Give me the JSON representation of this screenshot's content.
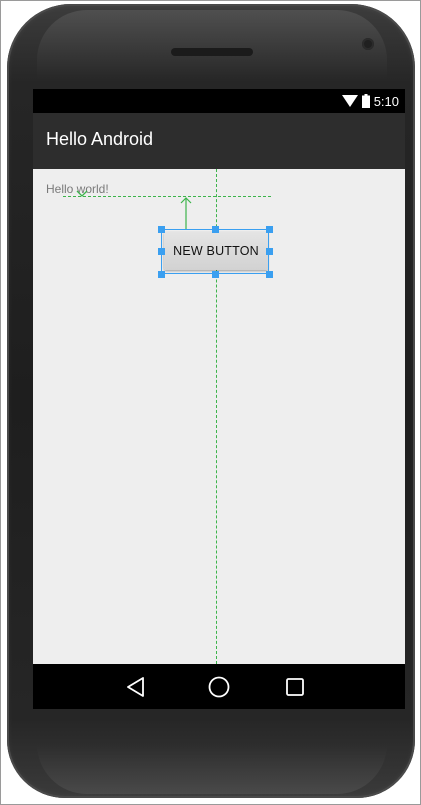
{
  "status_bar": {
    "time": "5:10"
  },
  "action_bar": {
    "title": "Hello Android"
  },
  "content": {
    "text_view": "Hello world!",
    "button_label": "NEW BUTTON"
  },
  "nav_bar": {
    "back": "back-icon",
    "home": "home-icon",
    "recents": "recents-icon"
  },
  "colors": {
    "action_bar": "#2d2d2d",
    "content_bg": "#eeeeee",
    "guide_green": "#3cb44b",
    "selection_blue": "#3a9ff0"
  }
}
